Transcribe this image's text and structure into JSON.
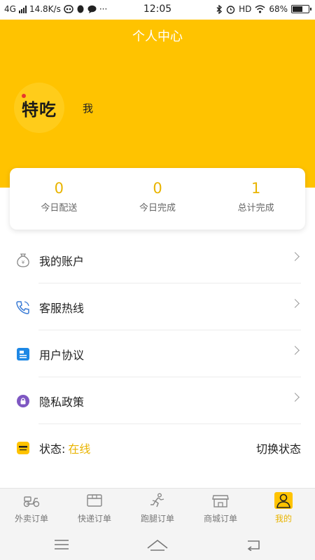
{
  "status_bar": {
    "network": "4G",
    "speed": "14.8K/s",
    "more": "···",
    "time": "12:05",
    "hd": "HD",
    "battery": "68%",
    "battery_level": 0.68
  },
  "header": {
    "title": "个人中心",
    "avatar_text": "特吃",
    "user_name": "我",
    "color": "#ffc300"
  },
  "stats": [
    {
      "value": "0",
      "label": "今日配送"
    },
    {
      "value": "0",
      "label": "今日完成"
    },
    {
      "value": "1",
      "label": "总计完成"
    }
  ],
  "menu": {
    "account": "我的账户",
    "hotline": "客服热线",
    "agreement": "用户协议",
    "privacy": "隐私政策",
    "status_label": "状态:",
    "status_value": "在线",
    "switch_label": "切换状态"
  },
  "tabs": [
    {
      "label": "外卖订单",
      "icon": "scooter-icon"
    },
    {
      "label": "快递订单",
      "icon": "package-icon"
    },
    {
      "label": "跑腿订单",
      "icon": "runner-icon"
    },
    {
      "label": "商城订单",
      "icon": "shop-icon"
    },
    {
      "label": "我的",
      "icon": "user-icon",
      "active": true
    }
  ],
  "colors": {
    "accent": "#e9b400",
    "header_bg": "#ffc300"
  }
}
